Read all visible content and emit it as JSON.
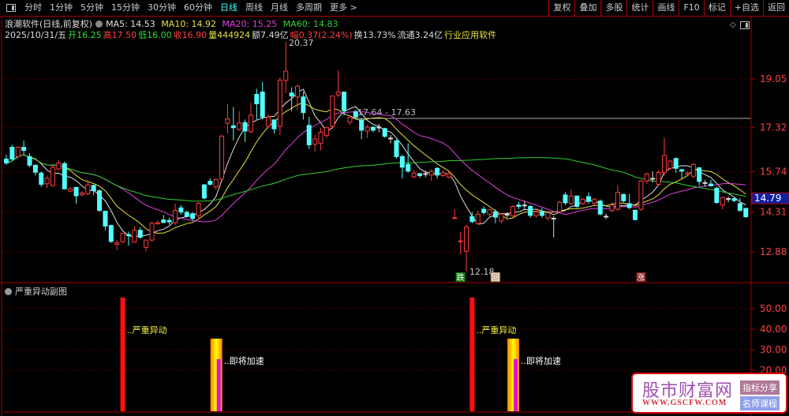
{
  "toolbar": {
    "tabs": [
      "分时",
      "1分钟",
      "5分钟",
      "15分钟",
      "30分钟",
      "60分钟",
      "日线",
      "周线",
      "月线",
      "多周期",
      "更多 >"
    ],
    "active_tab": "日线",
    "right_buttons": [
      "复权",
      "叠加",
      "多股",
      "统计",
      "画线",
      "F10",
      "标记",
      "+自选",
      "返回"
    ]
  },
  "header": {
    "title": "浪潮软件(日线,前复权)",
    "ma5": "MA5: 14.53",
    "ma10": "MA10: 14.92",
    "ma20": "MA20: 15.25",
    "ma60": "MA60: 14.83",
    "date": "2025/10/31/五",
    "open": "开16.25",
    "high": "高17.50",
    "low": "低16.00",
    "close": "收16.90",
    "volume": "量444924",
    "amount": "额7.49亿",
    "change": "幅0.37(2.24%)",
    "turnover": "换13.73%",
    "float_cap": "流通3.24亿",
    "industry": "行业应用软件"
  },
  "colors": {
    "up": "#ff3b3b",
    "down": "#54ffff",
    "ma5": "#e0e0e0",
    "ma10": "#e8e040",
    "ma20": "#e040e0",
    "ma60": "#30d030",
    "grid": "#800000",
    "axis_text": "#ff4040",
    "current_price_bg": "#1020a0"
  },
  "chart_data": [
    {
      "type": "candlestick",
      "fields": [
        "open",
        "high",
        "low",
        "close"
      ],
      "ylim": [
        12.0,
        20.5
      ],
      "y_ticks": [
        "19.05",
        "17.32",
        "15.74",
        "14.31",
        "12.88"
      ],
      "current_price": "14.79",
      "max_label": "20.37",
      "min_label": "12.18",
      "hline_label": "17.64 - 17.63",
      "moving_averages": [
        "MA5",
        "MA10",
        "MA20",
        "MA60"
      ],
      "markers": [
        {
          "index": 78,
          "label": "跌",
          "color": "#108010"
        },
        {
          "index": 84,
          "label": "回",
          "color": "#c0a080"
        },
        {
          "index": 109,
          "label": "涨",
          "color": "#802020"
        }
      ],
      "candles": [
        [
          16.19,
          16.35,
          15.98,
          16.05
        ],
        [
          16.61,
          16.7,
          16.15,
          16.19
        ],
        [
          16.28,
          16.65,
          16.2,
          16.61
        ],
        [
          16.61,
          16.85,
          16.35,
          16.5
        ],
        [
          16.28,
          16.4,
          15.9,
          15.97
        ],
        [
          15.97,
          16.0,
          15.6,
          15.72
        ],
        [
          15.69,
          15.75,
          15.2,
          15.29
        ],
        [
          15.31,
          15.6,
          15.15,
          15.5
        ],
        [
          15.25,
          15.95,
          15.2,
          15.9
        ],
        [
          15.84,
          16.15,
          15.8,
          16.05
        ],
        [
          16.03,
          16.1,
          15.1,
          15.13
        ],
        [
          15.05,
          15.2,
          15.0,
          15.13
        ],
        [
          15.18,
          15.2,
          14.6,
          14.88
        ],
        [
          14.92,
          15.05,
          14.85,
          14.98
        ],
        [
          14.95,
          15.45,
          14.9,
          15.27
        ],
        [
          15.25,
          15.28,
          14.9,
          15.06
        ],
        [
          15.06,
          15.1,
          14.3,
          14.36
        ],
        [
          14.33,
          14.35,
          13.65,
          13.8
        ],
        [
          13.82,
          13.85,
          13.2,
          13.25
        ],
        [
          13.15,
          13.3,
          12.95,
          13.2
        ],
        [
          13.25,
          13.55,
          13.2,
          13.54
        ],
        [
          13.5,
          13.6,
          13.1,
          13.46
        ],
        [
          13.23,
          13.8,
          13.2,
          13.65
        ],
        [
          13.65,
          13.75,
          13.35,
          13.4
        ],
        [
          13.04,
          13.3,
          12.9,
          13.3
        ],
        [
          13.3,
          13.95,
          13.25,
          13.9
        ],
        [
          13.88,
          14.0,
          13.85,
          13.92
        ],
        [
          14.02,
          14.2,
          13.9,
          13.93
        ],
        [
          14.0,
          14.1,
          13.85,
          13.95
        ],
        [
          13.92,
          14.6,
          13.85,
          14.36
        ],
        [
          14.45,
          14.55,
          14.2,
          14.3
        ],
        [
          14.29,
          14.35,
          14.1,
          14.15
        ],
        [
          14.24,
          14.3,
          14.0,
          14.07
        ],
        [
          14.17,
          14.65,
          14.05,
          14.61
        ],
        [
          15.27,
          15.3,
          14.75,
          14.8
        ],
        [
          15.4,
          15.5,
          15.25,
          15.29
        ],
        [
          15.2,
          15.5,
          15.1,
          15.46
        ],
        [
          15.48,
          17.05,
          15.45,
          17.01
        ],
        [
          17.47,
          18.15,
          17.1,
          17.62
        ],
        [
          17.38,
          18.05,
          16.85,
          17.31
        ],
        [
          17.25,
          17.9,
          17.2,
          17.48
        ],
        [
          17.49,
          17.6,
          16.8,
          17.19
        ],
        [
          17.17,
          18.2,
          17.1,
          17.76
        ],
        [
          18.5,
          18.7,
          17.6,
          18.16
        ],
        [
          18.58,
          18.95,
          17.6,
          17.69
        ],
        [
          17.36,
          17.8,
          17.3,
          17.69
        ],
        [
          17.59,
          17.6,
          17.1,
          17.27
        ],
        [
          17.36,
          19.1,
          17.05,
          19.0
        ],
        [
          19.0,
          20.37,
          18.55,
          19.33
        ],
        [
          18.55,
          18.75,
          17.9,
          18.44
        ],
        [
          18.41,
          18.85,
          17.95,
          18.79
        ],
        [
          18.41,
          18.6,
          17.6,
          17.85
        ],
        [
          17.39,
          17.7,
          16.55,
          16.7
        ],
        [
          16.72,
          17.05,
          16.45,
          16.91
        ],
        [
          16.75,
          17.3,
          16.5,
          17.15
        ],
        [
          17.03,
          17.35,
          16.95,
          17.31
        ],
        [
          17.36,
          18.45,
          17.3,
          18.44
        ],
        [
          18.48,
          19.35,
          18.4,
          18.58
        ],
        [
          18.58,
          18.6,
          17.75,
          17.92
        ],
        [
          17.5,
          17.75,
          17.4,
          17.69
        ],
        [
          17.88,
          17.95,
          17.6,
          17.69
        ],
        [
          17.59,
          17.65,
          16.9,
          17.22
        ],
        [
          17.19,
          17.4,
          16.95,
          17.33
        ],
        [
          17.33,
          17.35,
          17.15,
          17.22
        ],
        [
          17.33,
          17.45,
          17.15,
          17.31
        ],
        [
          17.28,
          17.3,
          16.95,
          17.0
        ],
        [
          16.94,
          17.05,
          16.75,
          16.92
        ],
        [
          16.84,
          16.9,
          16.2,
          16.28
        ],
        [
          16.28,
          16.35,
          15.5,
          15.9
        ],
        [
          16.0,
          16.75,
          15.7,
          15.76
        ],
        [
          15.56,
          15.8,
          15.5,
          15.69
        ],
        [
          15.67,
          15.7,
          15.52,
          15.6
        ],
        [
          15.67,
          15.78,
          15.55,
          15.66
        ],
        [
          15.62,
          15.82,
          15.4,
          15.76
        ],
        [
          15.86,
          15.9,
          15.5,
          15.62
        ],
        [
          15.6,
          15.8,
          15.55,
          15.7
        ],
        [
          15.55,
          15.75,
          15.5,
          15.67
        ],
        [
          14.1,
          14.4,
          14.1,
          14.1
        ],
        [
          13.25,
          13.6,
          12.8,
          13.27
        ],
        [
          12.9,
          13.85,
          12.18,
          13.77
        ],
        [
          14.14,
          14.3,
          13.9,
          13.96
        ],
        [
          13.89,
          14.35,
          13.85,
          14.22
        ],
        [
          14.4,
          14.5,
          14.2,
          14.28
        ],
        [
          14.22,
          14.4,
          14.15,
          14.38
        ],
        [
          14.31,
          14.4,
          13.9,
          14.12
        ],
        [
          13.98,
          14.28,
          13.9,
          14.23
        ],
        [
          14.22,
          14.3,
          14.1,
          14.2
        ],
        [
          14.17,
          14.55,
          14.1,
          14.5
        ],
        [
          14.55,
          14.65,
          14.4,
          14.5
        ],
        [
          14.55,
          14.7,
          14.4,
          14.53
        ],
        [
          14.5,
          14.55,
          14.1,
          14.18
        ],
        [
          14.17,
          14.4,
          14.1,
          14.31
        ],
        [
          14.31,
          14.45,
          14.1,
          14.18
        ],
        [
          14.09,
          14.3,
          14.0,
          14.27
        ],
        [
          14.08,
          14.15,
          13.4,
          14.07
        ],
        [
          14.31,
          14.7,
          14.25,
          14.65
        ],
        [
          14.91,
          15.0,
          14.55,
          14.63
        ],
        [
          14.6,
          15.1,
          14.55,
          14.87
        ],
        [
          14.87,
          14.9,
          14.45,
          14.5
        ],
        [
          14.6,
          14.8,
          14.55,
          14.76
        ],
        [
          14.85,
          15.0,
          14.6,
          14.68
        ],
        [
          14.61,
          14.8,
          14.55,
          14.76
        ],
        [
          14.69,
          14.75,
          14.18,
          14.23
        ],
        [
          14.15,
          14.25,
          14.05,
          14.14
        ],
        [
          14.36,
          14.65,
          14.3,
          14.55
        ],
        [
          14.4,
          15.25,
          14.35,
          15.0
        ],
        [
          14.93,
          14.95,
          14.65,
          14.7
        ],
        [
          14.6,
          14.95,
          14.4,
          14.46
        ],
        [
          14.36,
          14.4,
          14.0,
          14.03
        ],
        [
          14.4,
          15.45,
          14.35,
          15.41
        ],
        [
          15.41,
          15.7,
          15.3,
          15.66
        ],
        [
          15.5,
          15.75,
          15.35,
          15.48
        ],
        [
          15.29,
          15.8,
          15.25,
          15.71
        ],
        [
          15.71,
          16.95,
          15.6,
          16.32
        ],
        [
          15.86,
          16.15,
          15.8,
          16.12
        ],
        [
          16.21,
          16.25,
          15.7,
          15.86
        ],
        [
          15.81,
          15.85,
          15.5,
          15.76
        ],
        [
          15.65,
          15.75,
          15.6,
          15.69
        ],
        [
          15.58,
          16.05,
          15.5,
          16.0
        ],
        [
          15.88,
          15.9,
          15.25,
          15.39
        ],
        [
          15.35,
          15.45,
          15.2,
          15.34
        ],
        [
          15.3,
          15.45,
          15.2,
          15.24
        ],
        [
          15.15,
          15.2,
          14.6,
          14.64
        ],
        [
          14.55,
          14.85,
          14.4,
          14.82
        ],
        [
          14.78,
          14.85,
          14.65,
          14.77
        ],
        [
          14.78,
          14.8,
          14.65,
          14.71
        ],
        [
          14.6,
          14.8,
          14.3,
          14.36
        ],
        [
          14.43,
          14.45,
          14.1,
          14.13
        ]
      ]
    },
    {
      "type": "bar",
      "title": "严重异动副图",
      "y_ticks": [
        "50.00",
        "40.00",
        "30.00",
        "20.00"
      ],
      "ylim": [
        0,
        60
      ],
      "series": [
        {
          "name": "严重异动",
          "color": "#ff1010",
          "points": [
            {
              "index": 20,
              "value": 55.4
            },
            {
              "index": 80,
              "value": 55.4
            }
          ]
        },
        {
          "name": "即将加速",
          "color": "#ffa000",
          "points": [
            {
              "index": 36,
              "value": 35.4
            },
            {
              "index": 87,
              "value": 35.4
            }
          ]
        },
        {
          "color": "#e010e0",
          "points": [
            {
              "index": 36,
              "value": 25.4
            },
            {
              "index": 87,
              "value": 25.4
            }
          ]
        }
      ],
      "annotations": [
        {
          "index": 20,
          "text": "..严重异动",
          "value": 40
        },
        {
          "index": 80,
          "text": "..严重异动",
          "value": 40
        },
        {
          "index": 36,
          "text": "..即将加速",
          "value": 25
        },
        {
          "index": 87,
          "text": "..即将加速",
          "value": 25
        }
      ]
    }
  ],
  "watermark": {
    "name": "股市财富网",
    "url": "WWW.GSCFW.COM",
    "tag1": "指标分享",
    "tag2": "名师课程"
  }
}
